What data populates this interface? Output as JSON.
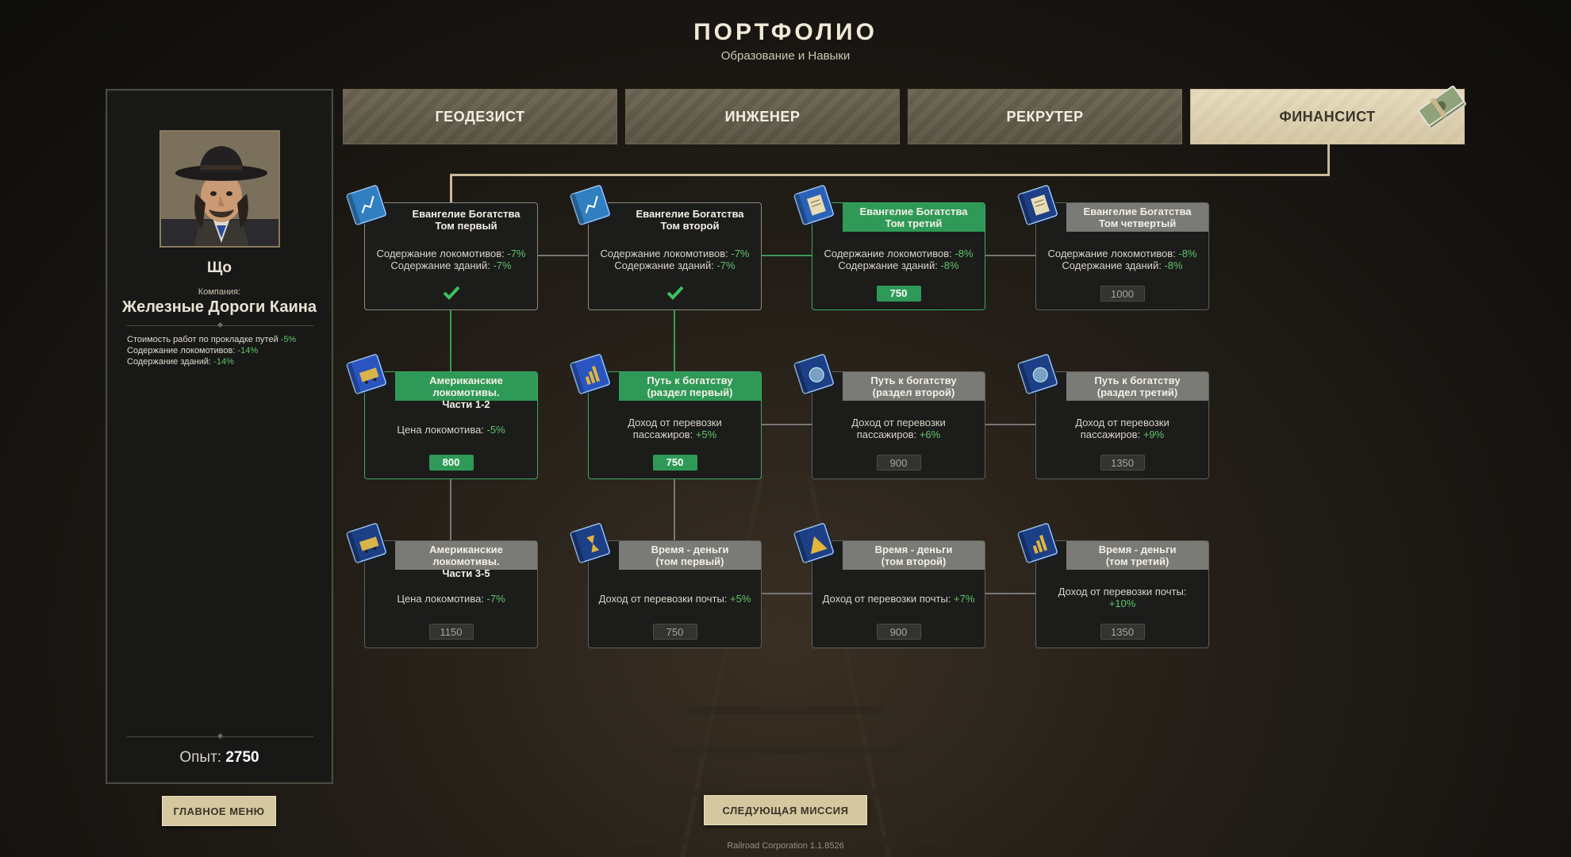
{
  "header": {
    "title": "ПОРТФОЛИО",
    "subtitle": "Образование и Навыки"
  },
  "profile": {
    "name": "Що",
    "company_label": "Компания:",
    "company_name": "Железные Дороги Каина",
    "bonuses": [
      {
        "label": "Стоимость работ по прокладке путей",
        "value": "-5%"
      },
      {
        "label": "Содержание локомотивов:",
        "value": "-14%"
      },
      {
        "label": "Содержание зданий:",
        "value": "-14%"
      }
    ],
    "xp_label": "Опыт:",
    "xp_value": "2750"
  },
  "tabs": [
    {
      "label": "ГЕОДЕЗИСТ",
      "active": false
    },
    {
      "label": "ИНЖЕНЕР",
      "active": false
    },
    {
      "label": "РЕКРУТЕР",
      "active": false
    },
    {
      "label": "ФИНАНСИСТ",
      "active": true
    }
  ],
  "skills": [
    {
      "state": "done",
      "title": "Евангелие Богатства\nТом первый",
      "lines": [
        {
          "text": "Содержание локомотивов: ",
          "value": "-7%"
        },
        {
          "text": "Содержание зданий: ",
          "value": "-7%"
        }
      ],
      "price": "",
      "book_color": "#2f7fc1",
      "book_icon": "chart"
    },
    {
      "state": "done",
      "title": "Евангелие Богатства\nТом второй",
      "lines": [
        {
          "text": "Содержание локомотивов: ",
          "value": "-7%"
        },
        {
          "text": "Содержание зданий: ",
          "value": "-7%"
        }
      ],
      "price": "",
      "book_color": "#2f7fc1",
      "book_icon": "chart"
    },
    {
      "state": "active",
      "title": "Евангелие Богатства\nТом третий",
      "lines": [
        {
          "text": "Содержание локомотивов: ",
          "value": "-8%"
        },
        {
          "text": "Содержание зданий: ",
          "value": "-8%"
        }
      ],
      "price": "750",
      "book_color": "#2a62b8",
      "book_icon": "doc"
    },
    {
      "state": "locked",
      "title": "Евангелие Богатства\nТом четвертый",
      "lines": [
        {
          "text": "Содержание локомотивов: ",
          "value": "-8%"
        },
        {
          "text": "Содержание зданий: ",
          "value": "-8%"
        }
      ],
      "price": "1000",
      "book_color": "#1d3f86",
      "book_icon": "doc"
    },
    {
      "state": "active",
      "title": "Американские локомотивы.\nЧасти 1-2",
      "lines": [
        {
          "text": "Цена локомотива: ",
          "value": "-5%"
        }
      ],
      "price": "800",
      "book_color": "#2a55c0",
      "book_icon": "train"
    },
    {
      "state": "active",
      "title": "Путь к богатству\n(раздел первый)",
      "lines": [
        {
          "text": "Доход от перевозки\nпассажиров: ",
          "value": "+5%"
        }
      ],
      "price": "750",
      "book_color": "#2a55c0",
      "book_icon": "bars"
    },
    {
      "state": "locked",
      "title": "Путь к богатству\n(раздел второй)",
      "lines": [
        {
          "text": "Доход от перевозки\nпассажиров: ",
          "value": "+6%"
        }
      ],
      "price": "900",
      "book_color": "#1d3f86",
      "book_icon": "globe"
    },
    {
      "state": "locked",
      "title": "Путь к богатству\n(раздел третий)",
      "lines": [
        {
          "text": "Доход от перевозки\nпассажиров: ",
          "value": "+9%"
        }
      ],
      "price": "1350",
      "book_color": "#1d3f86",
      "book_icon": "globe"
    },
    {
      "state": "locked",
      "title": "Американские локомотивы.\nЧасти 3-5",
      "lines": [
        {
          "text": "Цена локомотива: ",
          "value": "-7%"
        }
      ],
      "price": "1150",
      "book_color": "#1d3f86",
      "book_icon": "train"
    },
    {
      "state": "locked",
      "title": "Время - деньги\n(том первый)",
      "lines": [
        {
          "text": "Доход от перевозки почты: ",
          "value": "+5%"
        }
      ],
      "price": "750",
      "book_color": "#1d3f86",
      "book_icon": "hour"
    },
    {
      "state": "locked",
      "title": "Время - деньги\n(том второй)",
      "lines": [
        {
          "text": "Доход от перевозки почты: ",
          "value": "+7%"
        }
      ],
      "price": "900",
      "book_color": "#1d3f86",
      "book_icon": "pyramid"
    },
    {
      "state": "locked",
      "title": "Время - деньги\n(том третий)",
      "lines": [
        {
          "text": "Доход от перевозки почты:\n",
          "value": "+10%"
        }
      ],
      "price": "1350",
      "book_color": "#1d3f86",
      "book_icon": "bars"
    }
  ],
  "buttons": {
    "main_menu": "ГЛАВНОЕ МЕНЮ",
    "next_mission": "СЛЕДУЮЩАЯ МИССИЯ"
  },
  "version": "Railroad Corporation 1.1.8526"
}
